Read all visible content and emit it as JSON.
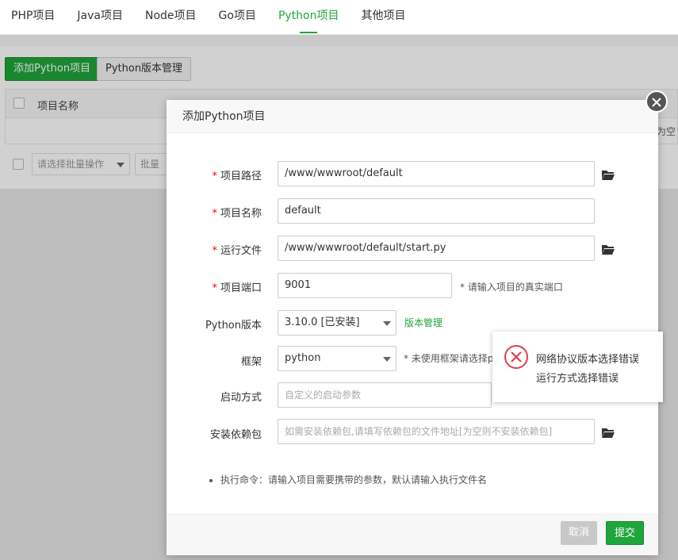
{
  "tabs": [
    {
      "label": "PHP项目",
      "active": false
    },
    {
      "label": "Java项目",
      "active": false
    },
    {
      "label": "Node项目",
      "active": false
    },
    {
      "label": "Go项目",
      "active": false
    },
    {
      "label": "Python项目",
      "active": true
    },
    {
      "label": "其他项目",
      "active": false
    }
  ],
  "toolbar": {
    "add_label": "添加Python项目",
    "version_label": "Python版本管理"
  },
  "table": {
    "col_name": "项目名称",
    "empty_partial": "为空"
  },
  "batch": {
    "select_placeholder": "请选择批量操作",
    "button_partial": "批量"
  },
  "modal": {
    "title": "添加Python项目",
    "fields": {
      "path": {
        "label": "项目路径",
        "value": "/www/wwwroot/default"
      },
      "name": {
        "label": "项目名称",
        "value": "default"
      },
      "run_file": {
        "label": "运行文件",
        "value": "/www/wwwroot/default/start.py"
      },
      "port": {
        "label": "项目端口",
        "value": "9001",
        "hint": "* 请输入项目的真实端口"
      },
      "python_version": {
        "label": "Python版本",
        "value": "3.10.0 [已安装]",
        "link": "版本管理"
      },
      "framework": {
        "label": "框架",
        "value": "python",
        "hint": "* 未使用框架请选择p"
      },
      "start_mode": {
        "label": "启动方式",
        "placeholder": "自定义的启动参数"
      },
      "deps": {
        "label": "安装依赖包",
        "placeholder": "如需安装依赖包,请填写依赖包的文件地址[为空则不安装依赖包]"
      }
    },
    "note": "执行命令：请输入项目需要携带的参数，默认请输入执行文件名",
    "cancel_label": "取消",
    "submit_label": "提交"
  },
  "toast": {
    "line1": "网络协议版本选择错误",
    "line2": "运行方式选择错误"
  },
  "colors": {
    "accent": "#20a53a",
    "required": "#ef0808",
    "error": "#e0404a"
  }
}
